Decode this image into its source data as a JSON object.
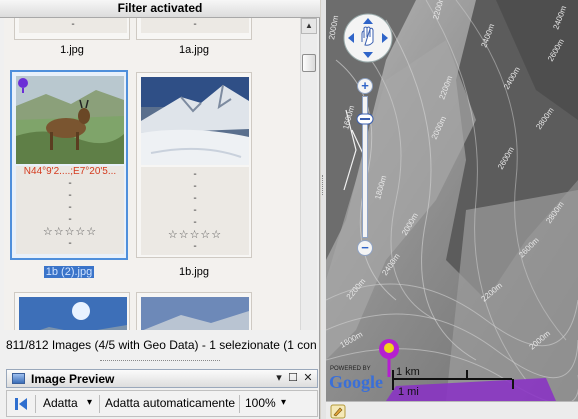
{
  "filter_bar": {
    "title": "Filter activated"
  },
  "thumbnails": [
    {
      "filename": "1.jpg",
      "selected": false
    },
    {
      "filename": "1a.jpg",
      "selected": false
    },
    {
      "filename": "1b (2).jpg",
      "selected": true,
      "geo_text": "N44°9'2....;E7°20'5...",
      "meta_lines": [
        "-",
        "-",
        "-",
        "-"
      ],
      "stars": "☆☆☆☆☆",
      "bottom": "-"
    },
    {
      "filename": "1b.jpg",
      "selected": false,
      "meta_lines": [
        "-",
        "-",
        "-",
        "-",
        "-"
      ],
      "stars": "☆☆☆☆☆",
      "bottom": "-"
    },
    {
      "filename": "",
      "selected": false
    },
    {
      "filename": "",
      "selected": false
    }
  ],
  "top_row_meta": {
    "stars": "☆☆☆☆☆",
    "bottom": "-"
  },
  "status": {
    "text": "811/812 Images (4/5 with Geo Data) - 1 selezionate (1 con"
  },
  "preview_panel": {
    "title": "Image Preview",
    "buttons": [
      "▾",
      "☐",
      "✕"
    ]
  },
  "toolbar": {
    "fit_label": "Adatta",
    "auto_fit_label": "Adatta automaticamente",
    "zoom_value": "100%",
    "dropdown_glyph": "▾"
  },
  "map": {
    "contour_labels": [
      "2000m",
      "2200m",
      "2400m",
      "2400m",
      "2400m",
      "2600m",
      "2200m",
      "2000m",
      "1800m",
      "1600m",
      "2600m",
      "2800m",
      "2800m",
      "2600m",
      "2200m",
      "2000m",
      "2400m",
      "2200m",
      "1800m",
      "2000m"
    ],
    "zoom_in": "+",
    "zoom_out": "−",
    "attribution_powered": "POWERED BY",
    "attribution_logo": "Google",
    "scale_km": "1 km",
    "scale_mi": "1 mi",
    "colors": {
      "marker": "#b51fd0",
      "marker_head": "#f2d31a",
      "region": "#8a2fc7"
    }
  }
}
